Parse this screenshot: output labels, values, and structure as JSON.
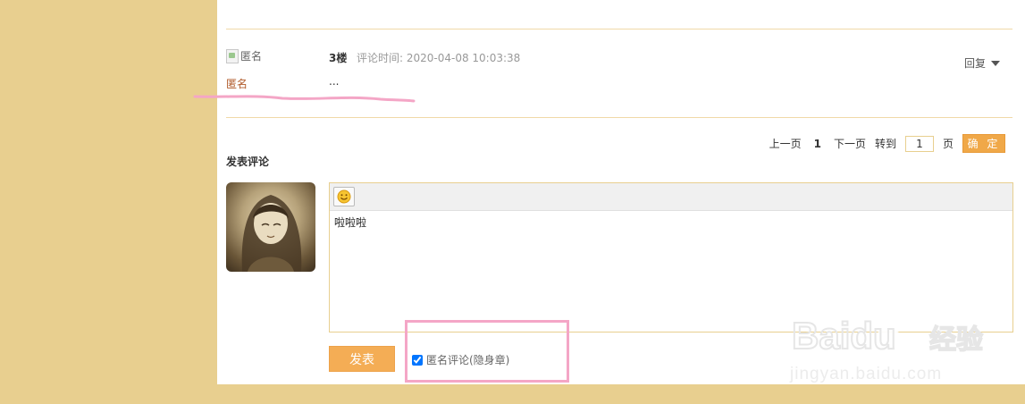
{
  "comment": {
    "avatar_alt": "匿名",
    "user_name": "匿名",
    "floor": "3楼",
    "time_label": "评论时间: 2020-04-08 10:03:38",
    "content": "...",
    "reply_label": "回复"
  },
  "pagination": {
    "prev_label": "上一页",
    "current_page": "1",
    "next_label": "下一页",
    "goto_label": "转到",
    "page_input_value": "1",
    "page_unit": "页",
    "confirm_label": "确 定"
  },
  "compose": {
    "section_title": "发表评论",
    "emoji_button": "emoji-smiley-icon",
    "textarea_value": "啦啦啦",
    "submit_label": "发表",
    "anonymous_label": "匿名评论(隐身章)",
    "anonymous_checked": true
  },
  "watermark": {
    "brand": "Baidu",
    "brand_cn": "经验",
    "domain": "jingyan.baidu.com"
  },
  "colors": {
    "page_bg": "#e8cf8f",
    "accent_orange": "#f4ad55",
    "annotation_pink": "#f4a6c6",
    "username_brown": "#b05a2a"
  }
}
